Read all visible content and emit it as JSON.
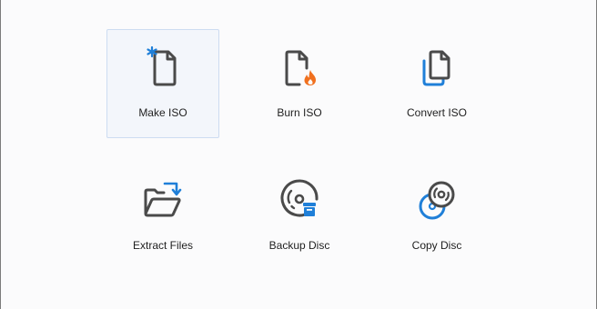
{
  "colors": {
    "icon_dark": "#4a4a4a",
    "accent_blue": "#1f7fd8",
    "flame_orange": "#f0701e",
    "selected_bg": "#f3f6fb",
    "selected_border": "#cddcf1"
  },
  "tiles": [
    {
      "label": "Make ISO",
      "icon": "new-file-icon",
      "selected": true
    },
    {
      "label": "Burn ISO",
      "icon": "burn-file-icon",
      "selected": false
    },
    {
      "label": "Convert ISO",
      "icon": "copy-files-icon",
      "selected": false
    },
    {
      "label": "Extract Files",
      "icon": "open-folder-icon",
      "selected": false
    },
    {
      "label": "Backup Disc",
      "icon": "disc-backup-icon",
      "selected": false
    },
    {
      "label": "Copy Disc",
      "icon": "copy-disc-icon",
      "selected": false
    }
  ]
}
